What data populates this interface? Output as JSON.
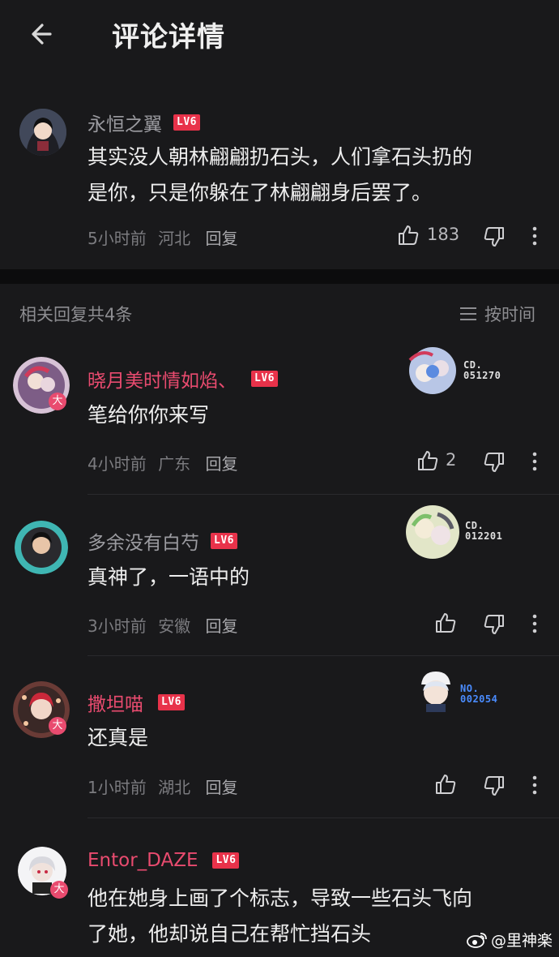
{
  "header": {
    "title": "评论详情"
  },
  "main_comment": {
    "username": "永恒之翼",
    "level": "LV6",
    "text_line1": "其实没人朝林翩翩扔石头，人们拿石头扔的",
    "text_line2": "是你，只是你躲在了林翩翩身后罢了。",
    "time": "5小时前",
    "location": "河北",
    "reply_label": "回复",
    "likes": "183"
  },
  "replies_header": {
    "count_text": "相关回复共4条",
    "sort_label": "按时间"
  },
  "replies": [
    {
      "username": "晓月美时情如焰、",
      "level": "LV6",
      "text": "笔给你你来写",
      "time": "4小时前",
      "location": "广东",
      "reply_label": "回复",
      "likes": "2",
      "badge_line1": "CD.",
      "badge_line2": "051270"
    },
    {
      "username": "多余没有白芍",
      "level": "LV6",
      "text": "真神了，一语中的",
      "time": "3小时前",
      "location": "安徽",
      "reply_label": "回复",
      "likes": "",
      "badge_line1": "CD.",
      "badge_line2": "012201"
    },
    {
      "username": "撒坦喵",
      "level": "LV6",
      "text": "还真是",
      "time": "1小时前",
      "location": "湖北",
      "reply_label": "回复",
      "likes": "",
      "badge_line1": "NO.",
      "badge_line2": "002054"
    },
    {
      "username": "Entor_DAZE",
      "level": "LV6",
      "text_line1": "他在她身上画了个标志，导致一些石头飞向",
      "text_line2": "了她，他却说自己在帮忙挡石头"
    }
  ],
  "avatar_badge": "大",
  "watermark": "@里神楽",
  "colors": {
    "background": "#19191b",
    "username_pink": "#e94b6f",
    "level_red": "#e8324a",
    "muted": "#7b7b7f"
  }
}
